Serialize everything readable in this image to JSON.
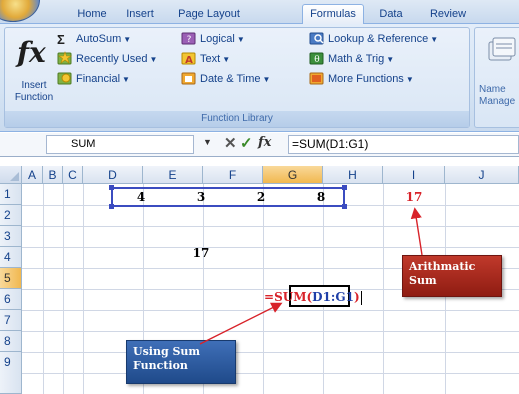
{
  "ribbon_tabs": [
    {
      "label": "Home",
      "active": false
    },
    {
      "label": "Insert",
      "active": false
    },
    {
      "label": "Page Layout",
      "active": false
    },
    {
      "label": "Formulas",
      "active": true
    },
    {
      "label": "Data",
      "active": false
    },
    {
      "label": "Review",
      "active": false
    }
  ],
  "ribbon": {
    "insert_function": {
      "glyph": "fx",
      "label_line1": "Insert",
      "label_line2": "Function"
    },
    "buttons": {
      "autosum": "AutoSum",
      "recently_used": "Recently Used",
      "financial": "Financial",
      "logical": "Logical",
      "text": "Text",
      "date_time": "Date & Time",
      "lookup_reference": "Lookup & Reference",
      "math_trig": "Math & Trig",
      "more_functions": "More Functions"
    },
    "group_label": "Function Library",
    "name_manager": {
      "label_line1": "Name",
      "label_line2": "Manage"
    }
  },
  "formula_bar": {
    "name_box": "SUM",
    "cancel_glyph": "✕",
    "enter_glyph": "✓",
    "fx_glyph": "fx",
    "formula": "=SUM(D1:G1)"
  },
  "sheet": {
    "columns": [
      "A",
      "B",
      "C",
      "D",
      "E",
      "F",
      "G",
      "H",
      "I",
      "J"
    ],
    "selected_column": "G",
    "rows": [
      "1",
      "2",
      "3",
      "4",
      "5",
      "6",
      "7",
      "8",
      "9"
    ],
    "selected_row": "5",
    "cells": {
      "D1": "4",
      "E1": "3",
      "F1": "2",
      "G1": "8",
      "I1": "17",
      "E3": "17"
    },
    "editing_formula": {
      "eq": "=",
      "fn": "SUM",
      "open": "(",
      "ref": "D1:G1",
      "close": ")"
    }
  },
  "callouts": {
    "arithmetic": {
      "line1": "Arithmatic",
      "line2": "Sum"
    },
    "using_sum": {
      "line1": "Using Sum",
      "line2": "Function"
    }
  },
  "colors": {
    "ribbon_text": "#15428b",
    "selection_border": "#3b4cc0",
    "callout_red": "#a8271d",
    "callout_blue": "#2b5aa0",
    "result_red": "#d8232a",
    "range_blue": "#1f3fa8"
  }
}
